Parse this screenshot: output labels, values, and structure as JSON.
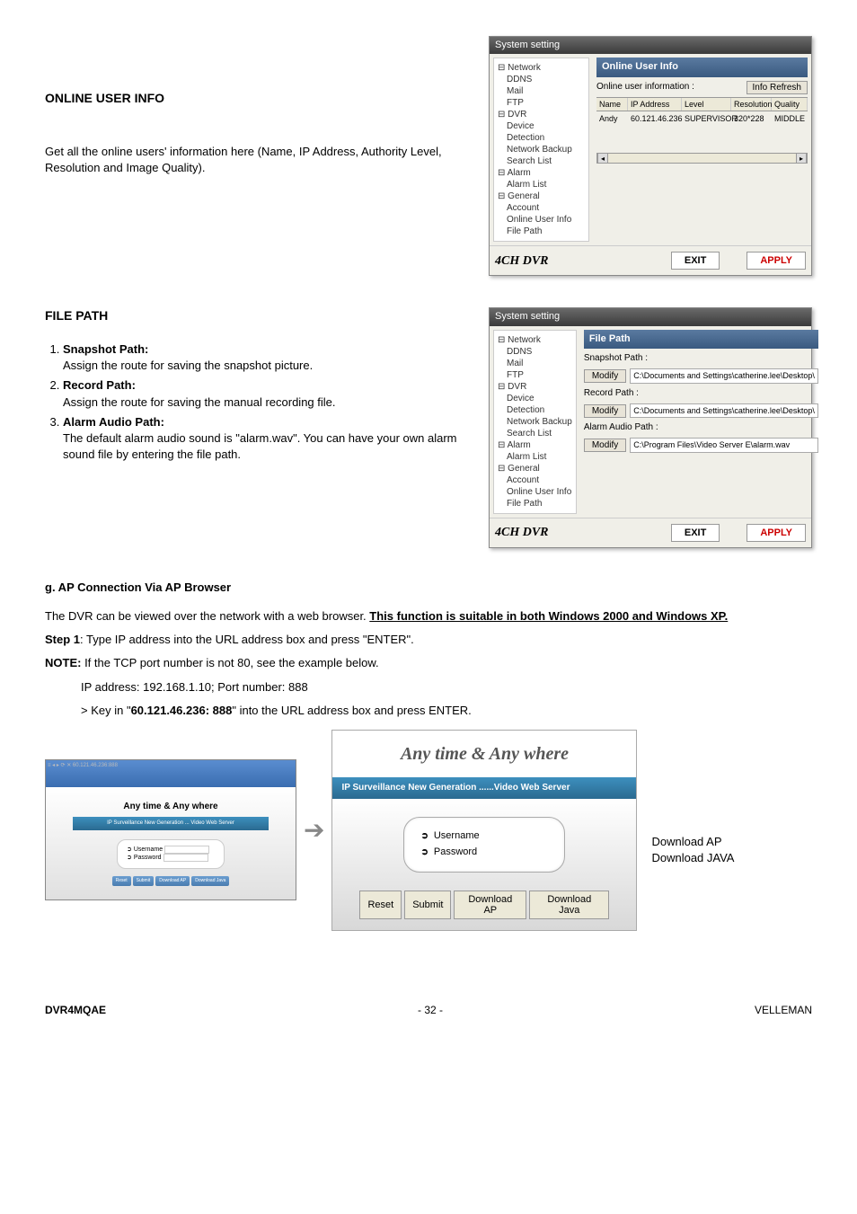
{
  "section1": {
    "title": "ONLINE USER INFO",
    "desc": "Get all the online users' information here (Name, IP Address, Authority Level, Resolution and Image Quality)."
  },
  "dialog1": {
    "windowTitle": "System setting",
    "panelTitle": "Online User Info",
    "infoText": "Online user information :",
    "infoBtn": "Info Refresh",
    "headers": [
      "Name",
      "IP Address",
      "Level",
      "Resolution",
      "Quality"
    ],
    "row": [
      "Andy",
      "60.121.46.236",
      "SUPERVISOR",
      "320*228",
      "MIDDLE"
    ]
  },
  "dialog2": {
    "panelTitle": "File Path",
    "snapshotLabel": "Snapshot Path :",
    "recordLabel": "Record Path :",
    "alarmLabel": "Alarm Audio Path :",
    "modifyBtn": "Modify",
    "path1": "C:\\Documents and Settings\\catherine.lee\\Desktop\\",
    "path2": "C:\\Documents and Settings\\catherine.lee\\Desktop\\",
    "path3": "C:\\Program Files\\Video Server E\\alarm.wav"
  },
  "tree": {
    "items": [
      "Network",
      "DDNS",
      "Mail",
      "FTP",
      "DVR",
      "Device",
      "Detection",
      "Network Backup",
      "Search List",
      "Alarm",
      "Alarm List",
      "General",
      "Account",
      "Online User Info",
      "File Path"
    ]
  },
  "brand": "4CH DVR",
  "exitBtn": "EXIT",
  "applyBtn": "APPLY",
  "section2": {
    "title": "FILE PATH",
    "item1": "Snapshot Path",
    "item1desc": "Assign the route for saving the snapshot picture.",
    "item2": "Record Path",
    "item2desc": "Assign the route for saving the manual recording file.",
    "item3": "Alarm Audio Path",
    "item3desc": "The default alarm audio sound is \"alarm.wav\". You can have your own alarm sound file by entering the file path."
  },
  "sectionG": {
    "title": "g.  AP Connection Via AP Browser",
    "desc1a": "The DVR can be viewed over the network with a web browser. ",
    "desc1b": "This function is suitable in both Windows 2000 and Windows XP.",
    "step1label": "Step 1",
    "step1text": ": Type IP address into the URL address box and press \"ENTER\".",
    "noteLabel": "NOTE:",
    "noteText": " If the TCP port number is not 80, see the example below.",
    "ipLine": "IP address: 192.168.1.10; Port number: 888",
    "keyLine1": "> Key in \"",
    "keyLine2": "60.121.46.236: 888",
    "keyLine3": "\" into the URL address box and press ENTER."
  },
  "loginBig": {
    "title": "Any time & Any where",
    "subtitle": "IP Surveillance New Generation ......Video Web Server",
    "userLabel": "Username",
    "passLabel": "Password",
    "btns": [
      "Reset",
      "Submit",
      "Download AP",
      "Download Java"
    ]
  },
  "loginMini": {
    "title": "Any time & Any where",
    "subtitle": "IP Surveillance New Generation ... Video Web Server",
    "userLabel": "Username",
    "passLabel": "Password"
  },
  "downloads": {
    "ap": "Download AP",
    "java": "Download JAVA"
  },
  "footer": {
    "model": "DVR4MQAE",
    "page": "- 32 -",
    "brand": "VELLEMAN"
  }
}
